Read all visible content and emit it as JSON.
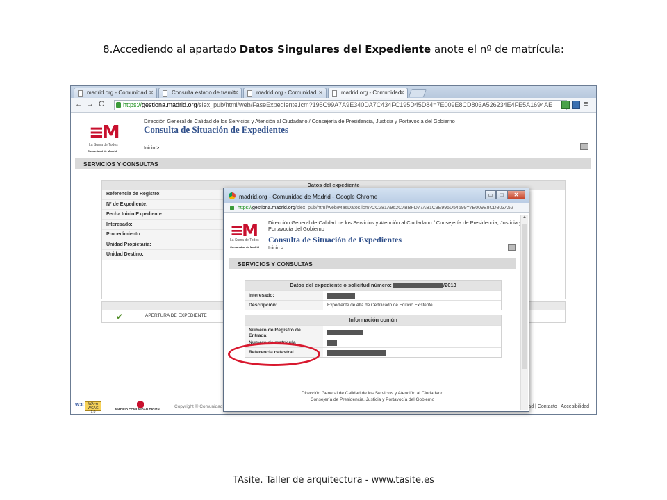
{
  "slide": {
    "title_pre": "8.Accediendo al apartado ",
    "title_bold": "Datos Singulares del Expediente",
    "title_post": " anote el nº de  matrícula:",
    "footer": "TAsite. Taller de arquitectura - www.tasite.es"
  },
  "browser": {
    "tabs": [
      {
        "label": "madrid.org - Comunidad"
      },
      {
        "label": "Consulta estado de tramit"
      },
      {
        "label": "madrid.org - Comunidad"
      },
      {
        "label": "madrid.org - Comunidad"
      }
    ],
    "url_https": "https://",
    "url_domain": "gestiona.madrid.org",
    "url_rest": "/siex_pub/html/web/FaseExpediente.icm?195C99A7A9E340DA7C434FC195D45D84=7E009E8CD803A526234E4FE5A1694AE"
  },
  "page": {
    "logo_em": "≡M",
    "logo_sub": "La Suma de Todos",
    "logo_cm": "Comunidad de Madrid",
    "direction": "Dirección General de Calidad de los Servicios y Atención al Ciudadano / Consejería de Presidencia, Justicia y Portavocía del Gobierno",
    "heading": "Consulta de Situación de Expedientes",
    "breadcrumb": "Inicio  >",
    "section": "SERVICIOS Y CONSULTAS",
    "panel_title": "Datos del expediente",
    "rows": [
      "Referencia de Registro:",
      "Nº de Expediente:",
      "Fecha Inicio Expediente:",
      "Interesado:",
      "Procedimiento:",
      "Unidad Propietaria:",
      "Unidad Destino:"
    ],
    "apertura": "APERTURA DE EXPEDIENTE",
    "check": "✔",
    "w3c": "W3C",
    "wai": "WAI-A WCAG 1.0",
    "mcd": "MADRID COMUNIDAD DIGITAL",
    "copyright": "Copyright © Comunidad",
    "footer_links": "idad | Contacto | Accesibilidad"
  },
  "popup": {
    "window_title": "madrid.org - Comunidad de Madrid - Google Chrome",
    "url_https": "https://",
    "url_domain": "gestiona.madrid.org",
    "url_rest": "/siex_pub/html/web/MasDatos.icm?CC281A962C7BBFD77AB1C3E995D54599=7E009E8CD803A52",
    "direction": "Dirección General de Calidad de los Servicios y Atención al Ciudadano / Consejería de Presidencia, Justicia y Portavocía del Gobierno",
    "heading": "Consulta de Situación de Expedientes",
    "breadcrumb": "Inicio  >",
    "section": "SERVICIOS Y CONSULTAS",
    "exp_title": "Datos del expediente o solicitud número:",
    "exp_year": "/2013",
    "interesado_label": "Interesado:",
    "descripcion_label": "Descripción:",
    "descripcion_value": "Expediente de Alta de Certificado de Edificio Existente",
    "info_title": "Información común",
    "registro_label": "Número de Registro de Entrada:",
    "matricula_label": "Numero de matrícula",
    "referencia_label": "Referencia catastral",
    "footer_line1": "Dirección General de Calidad de los Servicios y Atención al Ciudadano",
    "footer_line2": "Consejería de Presidencia, Justicia y Portavocía del Gobierno"
  },
  "colors": {
    "highlight_ellipse": "#d8182e",
    "brand_red": "#c8102e",
    "heading_blue": "#2f4f8a"
  }
}
